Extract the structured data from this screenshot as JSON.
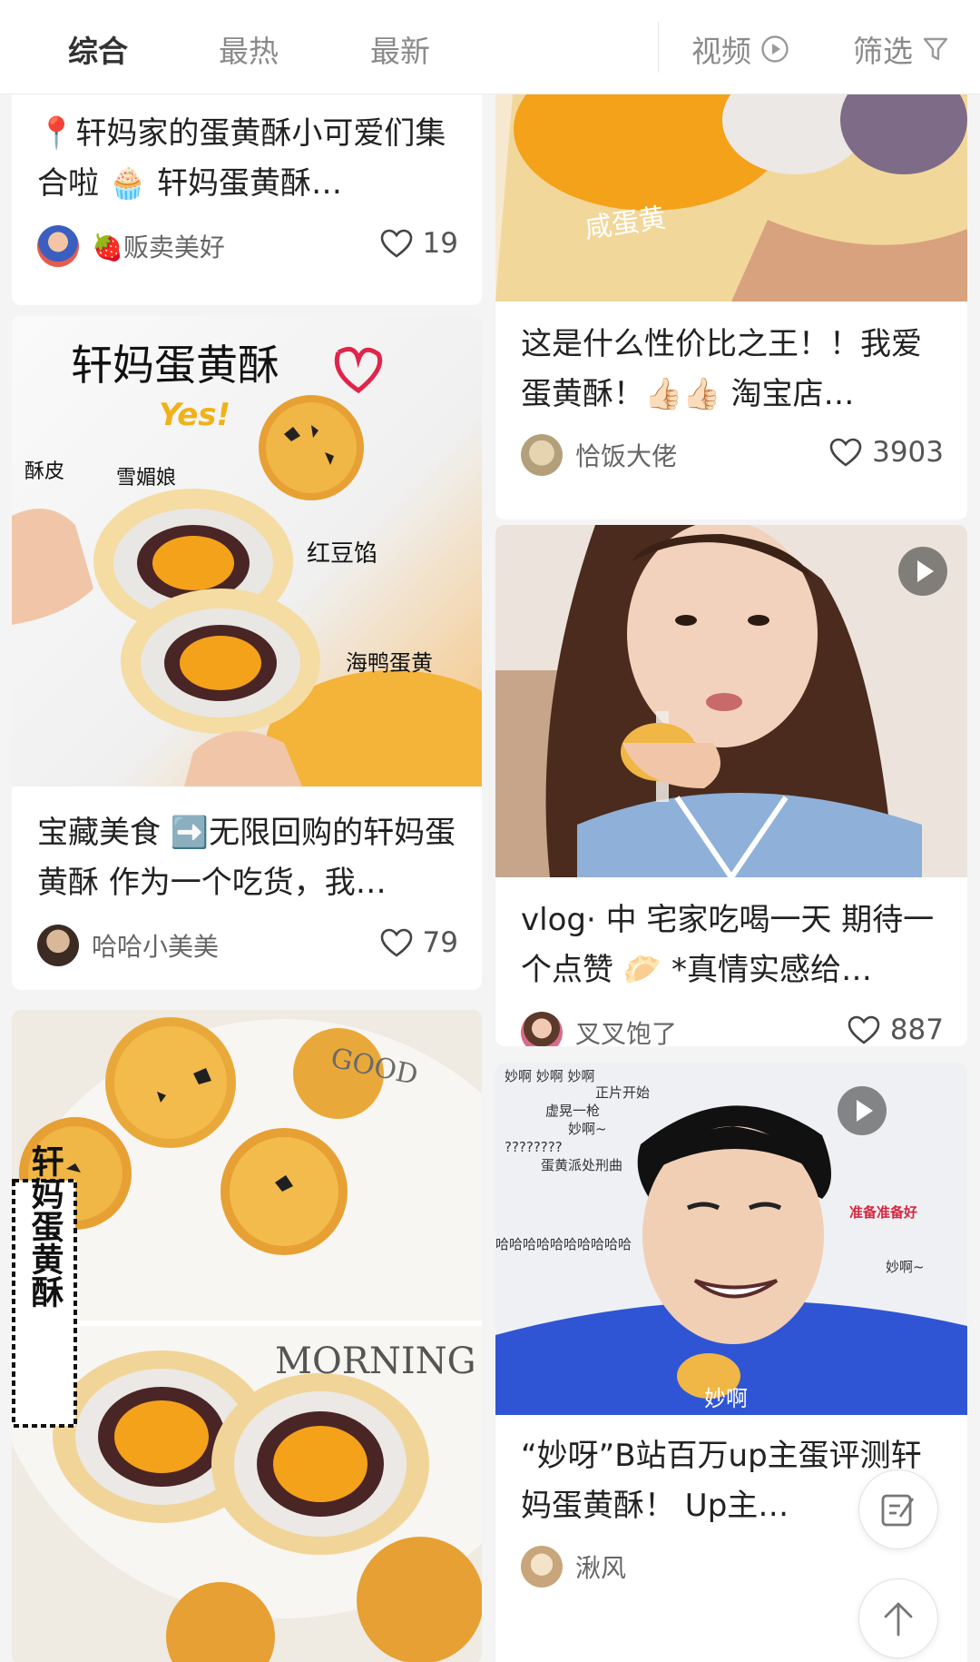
{
  "tabs": [
    {
      "label": "综合",
      "active": true
    },
    {
      "label": "最热",
      "active": false
    },
    {
      "label": "最新",
      "active": false
    }
  ],
  "tools": {
    "video_label": "视频",
    "filter_label": "筛选"
  },
  "cards": [
    {
      "title": "📍轩妈家的蛋黄酥小可爱们集合啦 🧁 轩妈蛋黄酥…",
      "author": "🍓贩卖美好",
      "likes": "19"
    },
    {
      "image_text": {
        "headline": "轩妈蛋黄酥",
        "yes": "Yes!",
        "a1": "酥皮",
        "a2": "雪媚娘",
        "a3": "红豆馅",
        "a4": "海鸭蛋黄"
      },
      "title": "宝藏美食 ➡️无限回购的轩妈蛋黄酥 作为一个吃货，我…",
      "author": "哈哈小美美",
      "likes": "79"
    },
    {
      "image_text": {
        "side": "轩妈蛋黄酥",
        "good": "GOOD",
        "morning": "MORNING"
      }
    },
    {
      "image_text": {
        "label": "咸蛋黄"
      },
      "title": "这是什么性价比之王！！我爱蛋黄酥！👍🏻👍🏻 淘宝店…",
      "author": "恰饭大佬",
      "likes": "3903"
    },
    {
      "title": "vlog· 中 宅家吃喝一天 期待一个点赞 🥟 *真情实感给…",
      "author": "叉叉饱了",
      "likes": "887"
    },
    {
      "image_text": {
        "caption": "妙啊",
        "danmaku": [
          "妙啊 妙啊 妙啊",
          "正片开始",
          "虚晃一枪",
          "妙啊~",
          "????????",
          "蛋黄派处刑曲",
          "哈哈哈哈哈哈哈哈哈哈",
          "准备准备好",
          "妙啊~"
        ]
      },
      "title": "“妙呀”B站百万up主蛋评测轩妈蛋黄酥！ Up主…",
      "author": "湫风"
    }
  ],
  "colors": {
    "yolk": "#f4a21a",
    "crust": "#f2d79b",
    "bean": "#4a2525",
    "shirt": "#2f55d4"
  },
  "icons": [
    "play-circle-icon",
    "filter-icon",
    "heart-icon",
    "play-icon",
    "edit-note-icon",
    "arrow-up-icon"
  ]
}
